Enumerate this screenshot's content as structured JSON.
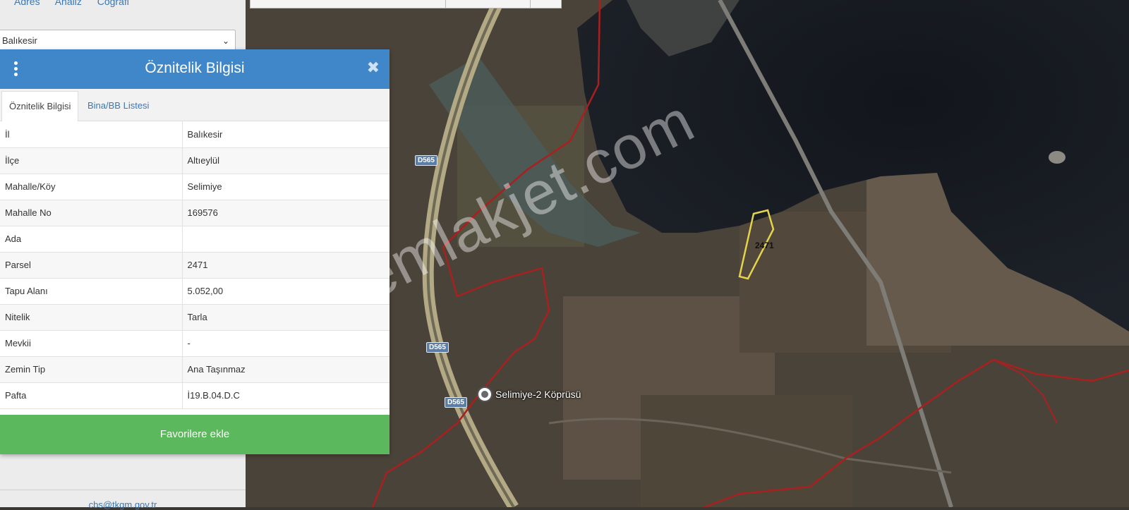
{
  "sidebar": {
    "top_links": [
      "Adres",
      "Analiz",
      "Coğrafi"
    ],
    "province_select_value": "Balıkesir",
    "contact_email": "cbs@tkgm.gov.tr"
  },
  "popup": {
    "title": "Öznitelik Bilgisi",
    "tabs": [
      "Öznitelik Bilgisi",
      "Bina/BB Listesi"
    ],
    "rows": [
      {
        "key": "İl",
        "value": "Balıkesir"
      },
      {
        "key": "İlçe",
        "value": "Altıeylül"
      },
      {
        "key": "Mahalle/Köy",
        "value": "Selimiye"
      },
      {
        "key": "Mahalle No",
        "value": "169576"
      },
      {
        "key": "Ada",
        "value": ""
      },
      {
        "key": "Parsel",
        "value": "2471"
      },
      {
        "key": "Tapu Alanı",
        "value": "5.052,00"
      },
      {
        "key": "Nitelik",
        "value": "Tarla"
      },
      {
        "key": "Mevkii",
        "value": "-"
      },
      {
        "key": "Zemin Tip",
        "value": "Ana Taşınmaz"
      },
      {
        "key": "Pafta",
        "value": "İ19.B.04.D.C"
      }
    ],
    "favorite_button": "Favorilere ekle"
  },
  "map": {
    "road_badges": [
      "D565",
      "D565",
      "D565"
    ],
    "parcel_label": "2471",
    "poi_label": "Selimiye-2 Köprüsü",
    "watermark": "emlakjet.com"
  }
}
